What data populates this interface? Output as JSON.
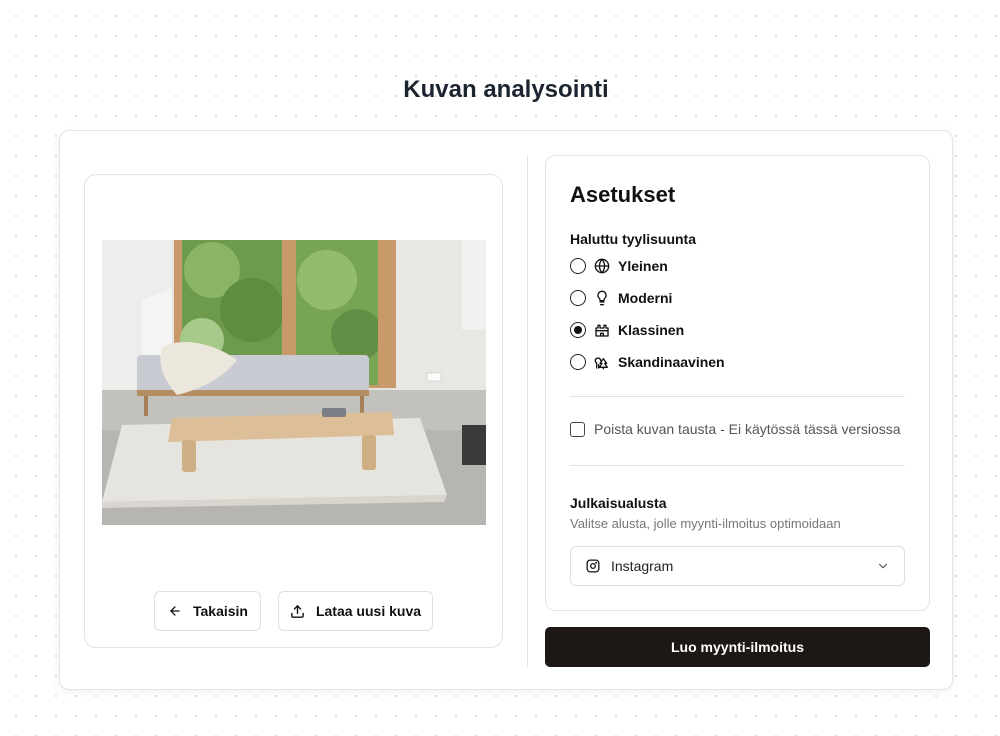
{
  "page": {
    "title": "Kuvan analysointi"
  },
  "preview": {
    "back_label": "Takaisin",
    "upload_label": "Lataa uusi kuva",
    "back_icon": "arrow-left-icon",
    "upload_icon": "upload-icon"
  },
  "settings": {
    "title": "Asetukset",
    "style_label": "Haluttu tyylisuunta",
    "styles": [
      {
        "label": "Yleinen",
        "icon": "globe-icon",
        "checked": false
      },
      {
        "label": "Moderni",
        "icon": "lightbulb-icon",
        "checked": false
      },
      {
        "label": "Klassinen",
        "icon": "castle-icon",
        "checked": true
      },
      {
        "label": "Skandinaavinen",
        "icon": "trees-icon",
        "checked": false
      }
    ],
    "remove_bg_label": "Poista kuvan tausta - Ei käytössä tässä versiossa",
    "remove_bg_checked": false,
    "platform_label": "Julkaisualusta",
    "platform_description": "Valitse alusta, jolle myynti-ilmoitus optimoidaan",
    "platform_value": "Instagram",
    "platform_icon": "instagram-icon"
  },
  "actions": {
    "create_label": "Luo myynti-ilmoitus"
  }
}
